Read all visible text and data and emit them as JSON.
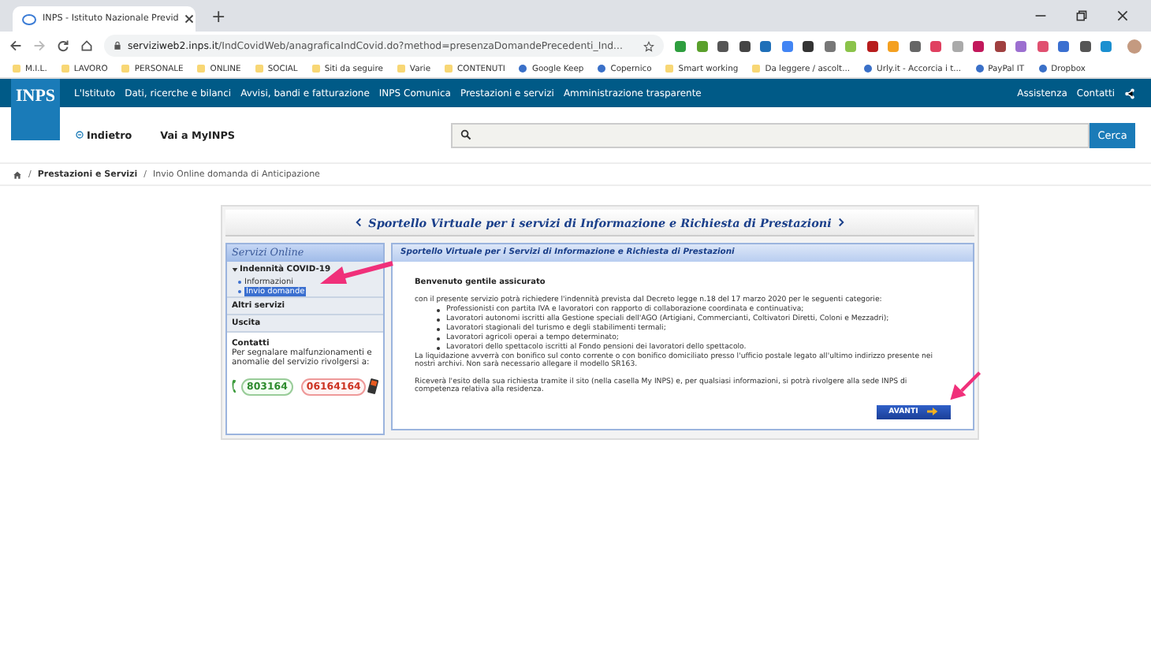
{
  "browser": {
    "tab_title": "INPS - Istituto Nazionale Previd",
    "new_tab": "+",
    "url_host": "serviziweb2.inps.it",
    "url_path": "/IndCovidWeb/anagraficaIndCovid.do?method=presenzaDomandePrecedenti_Ind...",
    "bookmarks": [
      {
        "label": "M.I.L.",
        "kind": "folder"
      },
      {
        "label": "LAVORO",
        "kind": "folder"
      },
      {
        "label": "PERSONALE",
        "kind": "folder"
      },
      {
        "label": "ONLINE",
        "kind": "folder"
      },
      {
        "label": "SOCIAL",
        "kind": "folder"
      },
      {
        "label": "Siti da seguire",
        "kind": "folder"
      },
      {
        "label": "Varie",
        "kind": "folder"
      },
      {
        "label": "CONTENUTI",
        "kind": "folder"
      },
      {
        "label": "Google Keep",
        "kind": "site"
      },
      {
        "label": "Copernico",
        "kind": "site"
      },
      {
        "label": "Smart working",
        "kind": "folder"
      },
      {
        "label": "Da leggere / ascolt...",
        "kind": "folder"
      },
      {
        "label": "Urly.it - Accorcia i t...",
        "kind": "site"
      },
      {
        "label": "PayPal IT",
        "kind": "site"
      },
      {
        "label": "Dropbox",
        "kind": "site"
      }
    ]
  },
  "site": {
    "logo": "INPS",
    "nav": [
      "L'Istituto",
      "Dati, ricerche e bilanci",
      "Avvisi, bandi e fatturazione",
      "INPS Comunica",
      "Prestazioni e servizi",
      "Amministrazione trasparente"
    ],
    "nav_right": [
      "Assistenza",
      "Contatti"
    ],
    "back": "Indietro",
    "myinps": "Vai a MyINPS",
    "search_button": "Cerca",
    "breadcrumb_separator": "/",
    "breadcrumb": [
      "Prestazioni e Servizi",
      "Invio Online domanda di Anticipazione"
    ]
  },
  "portal": {
    "title": "Sportello Virtuale per i servizi di Informazione e Richiesta di Prestazioni",
    "sidebar": {
      "heading": "Servizi Online",
      "sections": [
        {
          "label": "Indennità COVID-19",
          "expanded": true,
          "children": [
            {
              "label": "Informazioni",
              "selected": false
            },
            {
              "label": "Invio domande",
              "selected": true
            }
          ]
        },
        {
          "label": "Altri servizi",
          "expanded": false
        },
        {
          "label": "Uscita",
          "expanded": false
        }
      ],
      "contacts_title": "Contatti",
      "contacts_text": "Per segnalare malfunzionamenti e anomalie del servizio rivolgersi a:",
      "phone_green": "803164",
      "phone_red": "06164164"
    },
    "panel": {
      "heading": "Sportello Virtuale per i Servizi di Informazione e Richiesta di Prestazioni",
      "greeting": "Benvenuto gentile assicurato",
      "intro": "con il presente servizio potrà richiedere l'indennità prevista dal Decreto legge n.18 del 17 marzo 2020 per le seguenti categorie:",
      "categories": [
        "Professionisti con partita IVA e lavoratori con rapporto di collaborazione coordinata e continuativa;",
        "Lavoratori autonomi iscritti alla Gestione speciali dell'AGO (Artigiani, Commercianti, Coltivatori Diretti, Coloni e Mezzadri);",
        "Lavoratori stagionali del turismo e degli stabilimenti termali;",
        "Lavoratori agricoli operai a tempo determinato;",
        "Lavoratori dello spettacolo iscritti al Fondo pensioni dei lavoratori dello spettacolo."
      ],
      "payment": "La liquidazione avverrà con bonifico sul conto corrente o con bonifico domiciliato presso l'ufficio postale legato all'ultimo indirizzo presente nei nostri archivi. Non sarà necessario allegare il modello SR163.",
      "outcome": "Riceverà l'esito della sua richiesta tramite il sito (nella casella My INPS) e, per qualsiasi informazioni, si potrà rivolgere alla sede INPS di competenza relativa alla residenza.",
      "next_button": "AVANTI"
    }
  }
}
